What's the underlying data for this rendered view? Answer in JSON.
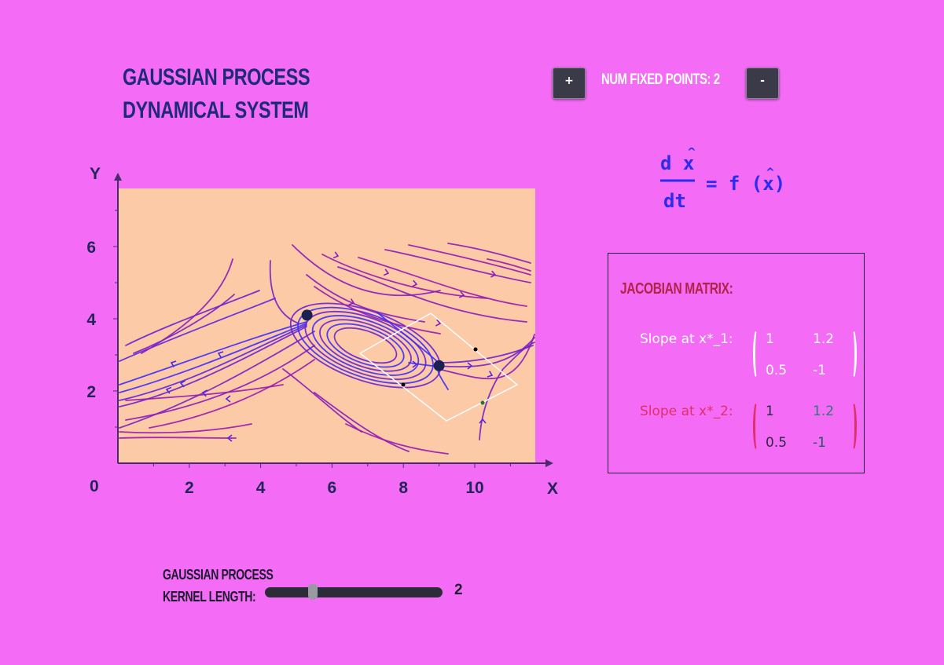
{
  "header": {
    "title_line1": "GAUSSIAN PROCESS",
    "title_line2": "DYNAMICAL SYSTEM",
    "plus_label": "+",
    "minus_label": "-",
    "fixed_points_label": "NUM FIXED POINTS: 2",
    "fixed_points_count": 2
  },
  "plot": {
    "x_axis_label": "X",
    "y_axis_label": "Y",
    "origin_label": "0",
    "x_ticks": [
      "2",
      "4",
      "6",
      "8",
      "10"
    ],
    "y_ticks": [
      "2",
      "4",
      "6"
    ],
    "colors": {
      "background": "#fccaa6",
      "axis": "#4a2a6a",
      "stream_blue": "#3b2cff",
      "stream_purple": "#9a18b0",
      "fixed_point": "#1a2050",
      "box": "#ffffff"
    },
    "fixed_points": [
      {
        "x": 5.3,
        "y": 4.1
      },
      {
        "x": 9.0,
        "y": 2.7
      }
    ]
  },
  "equation": {
    "numerator": "d x",
    "denominator": "dt",
    "rhs": "= f (x)",
    "color": "#2a2cf0"
  },
  "jacobian": {
    "title": "JACOBIAN MATRIX:",
    "rows": [
      {
        "label": "Slope at x*_1:",
        "values": [
          [
            "1",
            "1.2"
          ],
          [
            "0.5",
            "-1"
          ]
        ],
        "color": "#ffffff"
      },
      {
        "label": "Slope at x*_2:",
        "values": [
          [
            "1",
            "1.2"
          ],
          [
            "0.5",
            "-1"
          ]
        ],
        "color": "#e0306a"
      }
    ]
  },
  "kernel": {
    "label_line1": "GAUSSIAN PROCESS",
    "label_line2": "KERNEL LENGTH:",
    "value": "2",
    "slider_fraction": 0.27
  }
}
